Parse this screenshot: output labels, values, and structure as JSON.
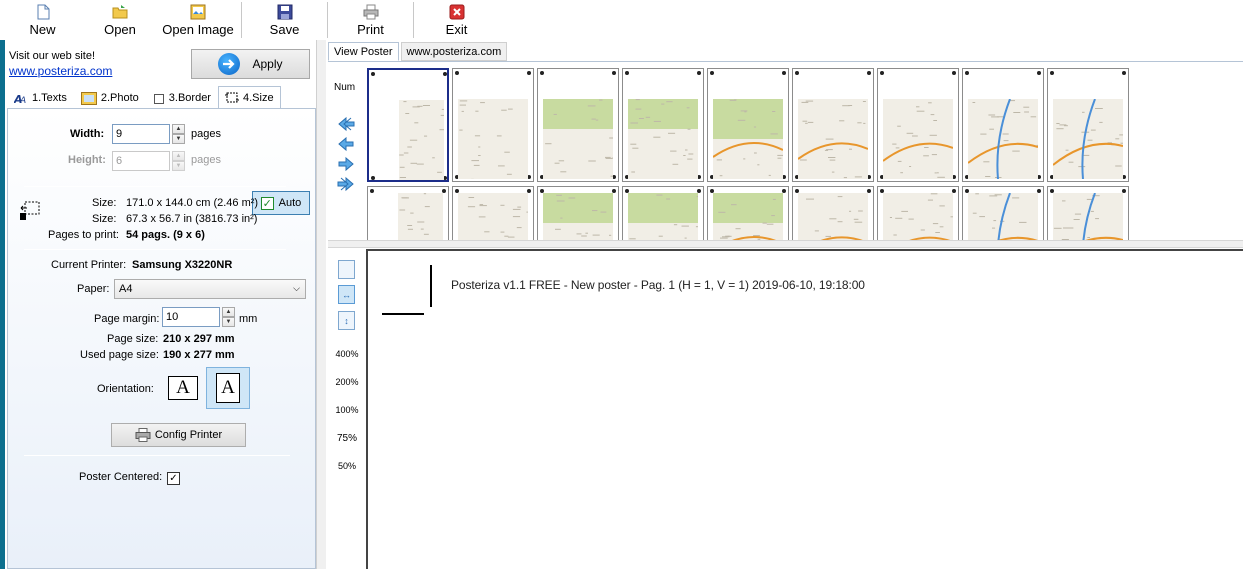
{
  "toolbar": {
    "new_label": "New",
    "open_label": "Open",
    "open_image_label": "Open Image",
    "save_label": "Save",
    "print_label": "Print",
    "exit_label": "Exit"
  },
  "visit": {
    "text": "Visit our web site!",
    "link": "www.posteriza.com"
  },
  "apply_label": "Apply",
  "tabs": [
    {
      "label": "1.Texts",
      "icon": "texts-icon"
    },
    {
      "label": "2.Photo",
      "icon": "photo-icon"
    },
    {
      "label": "3.Border",
      "icon": "border-icon"
    },
    {
      "label": "4.Size",
      "icon": "size-icon"
    }
  ],
  "size": {
    "width_label": "Width:",
    "width_value": "9",
    "width_unit": "pages",
    "height_label": "Height:",
    "height_value": "6",
    "height_unit": "pages",
    "auto_label": "Auto",
    "size_label1": "Size:",
    "size_value1": "171.0 x 144.0 cm (2.46 m²)",
    "size_label2": "Size:",
    "size_value2": "67.3 x 56.7 in (3816.73 in²)",
    "pages_label": "Pages to print:",
    "pages_value": "54 pags. (9 x 6)"
  },
  "printer": {
    "current_label": "Current Printer:",
    "current_value": "Samsung X3220NR",
    "paper_label": "Paper:",
    "paper_value": "A4",
    "margin_label": "Page margin:",
    "margin_value": "10",
    "margin_unit": "mm",
    "page_size_label": "Page size:",
    "page_size_value": "210 x 297 mm",
    "used_size_label": "Used page size:",
    "used_size_value": "190 x 277 mm",
    "orientation_label": "Orientation:",
    "config_label": "Config Printer",
    "centered_label": "Poster Centered:"
  },
  "right_tabs": [
    "View Poster",
    "www.posteriza.com"
  ],
  "num_label": "Num",
  "zoom_levels": [
    "400%",
    "200%",
    "100%",
    "75%",
    "50%"
  ],
  "preview_text": "Posteriza v1.1 FREE - New poster - Pag. 1 (H = 1, V = 1) 2019-06-10, 19:18:00",
  "colors": {
    "accent": "#0a64c6",
    "selected_bg": "#cfe6f7",
    "map_green": "#c8dba0",
    "map_road": "#e8962c",
    "map_water": "#4a8fd8"
  }
}
